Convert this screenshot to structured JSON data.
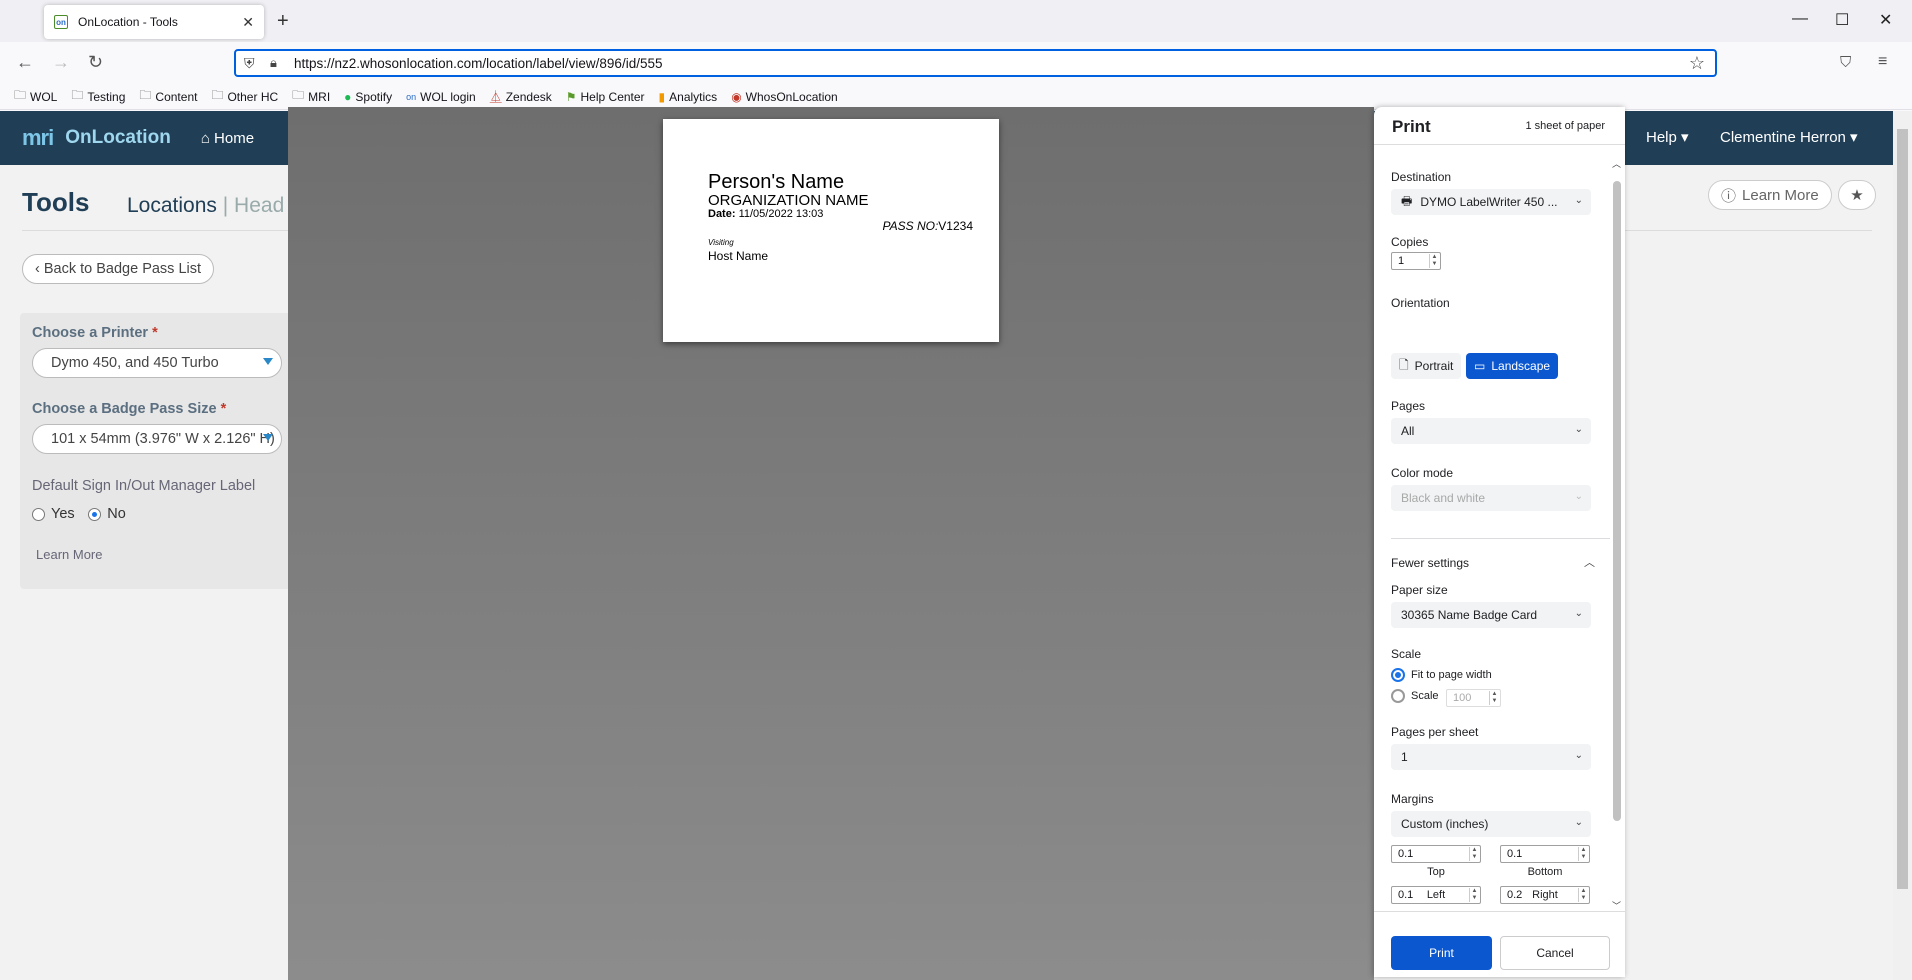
{
  "browser": {
    "tab_title": "OnLocation - Tools",
    "favicon_text": "on",
    "url": "https://nz2.whosonlocation.com/location/label/view/896/id/555",
    "bookmarks": [
      "WOL",
      "Testing",
      "Content",
      "Other HC",
      "MRI",
      "Spotify",
      "WOL login",
      "Zendesk",
      "Help Center",
      "Analytics",
      "WhosOnLocation"
    ]
  },
  "app": {
    "logo": "mri",
    "brand": "OnLocation",
    "nav_home": "Home",
    "help": "Help",
    "user": "Clementine Herron",
    "page_title": "Tools",
    "crumb_main": "Locations",
    "crumb_sub": "Head",
    "learn_more": "Learn More",
    "back_button": "Back to Badge Pass List",
    "form": {
      "printer_label": "Choose a Printer",
      "printer_value": "Dymo 450, and 450 Turbo",
      "size_label": "Choose a Badge Pass Size",
      "size_value": "101 x 54mm (3.976\" W x 2.126\" H)",
      "default_label": "Default Sign In/Out Manager Label",
      "yes": "Yes",
      "no": "No",
      "selected": "No",
      "learn_more": "Learn More"
    }
  },
  "label_preview": {
    "name": "Person's Name",
    "org": "ORGANIZATION NAME",
    "date_label": "Date:",
    "date_value": "11/05/2022 13:03",
    "pass_label": "PASS NO:",
    "pass_value": "V1234",
    "visiting": "Visiting",
    "host": "Host Name"
  },
  "print": {
    "title": "Print",
    "sheets": "1 sheet of paper",
    "destination_label": "Destination",
    "destination": "DYMO LabelWriter 450 ...",
    "copies_label": "Copies",
    "copies": "1",
    "orientation_label": "Orientation",
    "portrait": "Portrait",
    "landscape": "Landscape",
    "orientation_selected": "Landscape",
    "pages_label": "Pages",
    "pages": "All",
    "color_label": "Color mode",
    "color": "Black and white",
    "fewer": "Fewer settings",
    "paper_label": "Paper size",
    "paper": "30365 Name Badge Card",
    "scale_label": "Scale",
    "fit": "Fit to page width",
    "scale_opt": "Scale",
    "scale_value": "100",
    "pps_label": "Pages per sheet",
    "pps": "1",
    "margins_label": "Margins",
    "margins": "Custom (inches)",
    "top": "0.1",
    "top_label": "Top",
    "bottom": "0.1",
    "bottom_label": "Bottom",
    "left": "0.1",
    "left_label": "Left",
    "right": "0.2",
    "right_label": "Right",
    "print_btn": "Print",
    "cancel_btn": "Cancel"
  },
  "colors": {
    "header": "#203f56",
    "accent": "#0b57d0"
  }
}
